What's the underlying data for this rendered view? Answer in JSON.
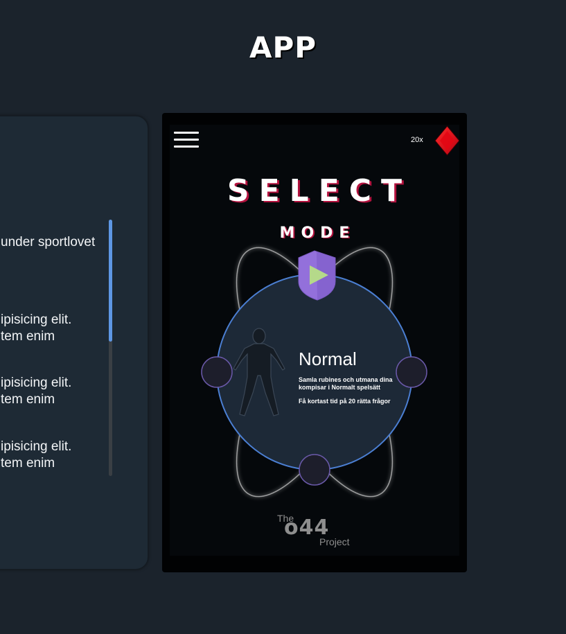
{
  "page": {
    "title": "APP"
  },
  "left_panel": {
    "items": [
      {
        "lines": [
          "under sportlovet"
        ]
      },
      {
        "lines": [
          "ipisicing elit.",
          "tem enim"
        ]
      },
      {
        "lines": [
          "ipisicing elit.",
          "tem enim"
        ]
      },
      {
        "lines": [
          "ipisicing elit.",
          "tem enim"
        ]
      }
    ],
    "scroll_position": 0.48
  },
  "app": {
    "gem_count": "20x",
    "select_title": "SELECT",
    "mode_title": "MODE",
    "mode": {
      "name": "Normal",
      "description": "Samla rubines och utmana dina kompisar i Normalt spelsätt",
      "time_rule": "Få kortast tid på 20 rätta frågor"
    },
    "logo": {
      "prefix": "The",
      "number": "o44",
      "suffix": "Project"
    },
    "colors": {
      "accent_blue": "#4b7fd3",
      "shield_purple": "#9370db",
      "play_green": "#b5d98a",
      "gem_red": "#e30613",
      "title_shadow": "#b3123e"
    }
  }
}
